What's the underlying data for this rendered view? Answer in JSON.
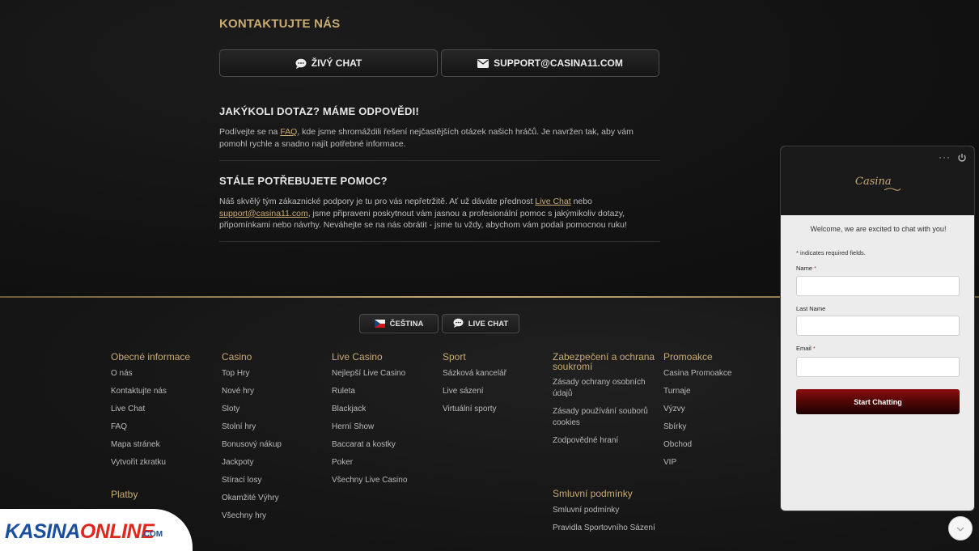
{
  "contact": {
    "title": "KONTAKTUJTE NÁS",
    "chat_label": "ŽIVÝ CHAT",
    "email_label": "SUPPORT@CASINA11.COM"
  },
  "faq_section": {
    "heading": "JAKÝKOLI DOTAZ? MÁME ODPOVĚDI!",
    "p1_before": "Podívejte se na ",
    "p1_link": "FAQ",
    "p1_after": ", kde jsme shromáždili řešení nejčastějších otázek našich hráčů. Je navržen tak, aby vám pomohl rychle a snadno najít potřebné informace."
  },
  "help_section": {
    "heading": "STÁLE POTŘEBUJETE POMOC?",
    "p_before": "Náš skvělý tým zákaznické podpory je tu pro vás nepřetržitě. Ať už dáváte přednost ",
    "p_link1": "Live Chat",
    "p_mid": " nebo ",
    "p_link2": "support@casina11.com",
    "p_after": ", jsme připraveni poskytnout vám jasnou a profesionální pomoc s jakýmikoliv dotazy, připomínkami nebo návrhy. Neváhejte se na nás obrátit - jsme tu vždy, abychom vám podali pomocnou ruku!"
  },
  "footer_buttons": {
    "language": "ČEŠTINA",
    "live_chat": "LIVE CHAT"
  },
  "footer": {
    "general": {
      "title": "Obecné informace",
      "items": [
        "O nás",
        "Kontaktujte nás",
        "Live Chat",
        "FAQ",
        "Mapa stránek",
        "Vytvořit zkratku"
      ]
    },
    "payments_title": "Platby",
    "casino": {
      "title": "Casino",
      "items": [
        "Top Hry",
        "Nové hry",
        "Sloty",
        "Stolní hry",
        "Bonusový nákup",
        "Jackpoty",
        "Stírací losy",
        "Okamžité Výhry",
        "Všechny hry"
      ]
    },
    "live_casino": {
      "title": "Live Casino",
      "items": [
        "Nejlepší Live Casino",
        "Ruleta",
        "Blackjack",
        "Herní Show",
        "Baccarat a kostky",
        "Poker",
        "Všechny Live Casino"
      ]
    },
    "sport": {
      "title": "Sport",
      "items": [
        "Sázková kancelář",
        "Live sázení",
        "Virtuální sporty"
      ]
    },
    "security": {
      "title": "Zabezpečení a ochrana soukromí",
      "items": [
        "Zásady ochrany osobních údajů",
        "Zásady používání souborů cookies",
        "Zodpovědné hraní"
      ]
    },
    "terms": {
      "title": "Smluvní podmínky",
      "items": [
        "Smluvní podmínky",
        "Pravidla Sportovního Sázení"
      ]
    },
    "promo": {
      "title": "Promoakce",
      "items": [
        "Casina Promoakce",
        "Turnaje",
        "Výzvy",
        "Sbírky",
        "Obchod",
        "VIP"
      ]
    }
  },
  "chat_widget": {
    "logo": "Casina",
    "menu": "···",
    "welcome": "Welcome, we are excited to chat with you!",
    "required_note": "* indicates required fields.",
    "name_label": "Name",
    "last_name_label": "Last Name",
    "email_label": "Email",
    "asterisk": "*",
    "start_button": "Start Chatting"
  },
  "watermark": {
    "kasina": "KASINA",
    "online": "ONLINE",
    "com": ".COM"
  },
  "colors": {
    "gold": "#c9ab72",
    "background": "#141414",
    "chat_button": "#8a0e0e"
  }
}
